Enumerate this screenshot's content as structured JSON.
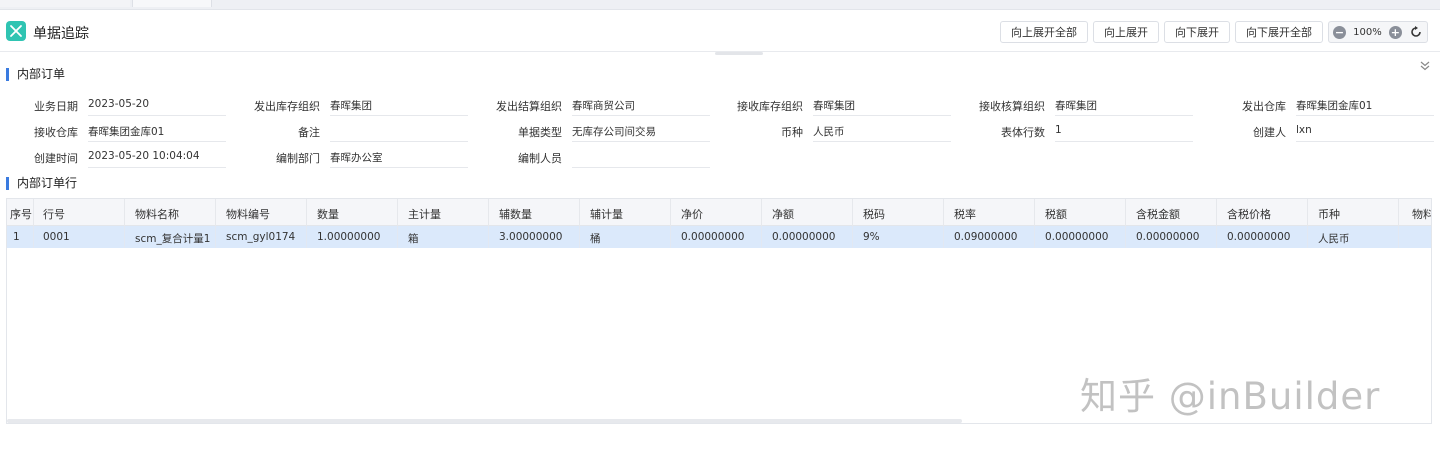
{
  "header": {
    "title": "单据追踪",
    "buttons": [
      "向上展开全部",
      "向上展开",
      "向下展开",
      "向下展开全部"
    ],
    "zoom": "100%"
  },
  "section_order": {
    "title": "内部订单"
  },
  "form": {
    "row1": [
      {
        "label": "业务日期",
        "value": "2023-05-20"
      },
      {
        "label": "发出库存组织",
        "value": "春晖集团"
      },
      {
        "label": "发出结算组织",
        "value": "春晖商贸公司"
      },
      {
        "label": "接收库存组织",
        "value": "春晖集团"
      },
      {
        "label": "接收核算组织",
        "value": "春晖集团"
      },
      {
        "label": "发出仓库",
        "value": "春晖集团金库01"
      }
    ],
    "row2": [
      {
        "label": "接收仓库",
        "value": "春晖集团金库01"
      },
      {
        "label": "备注",
        "value": ""
      },
      {
        "label": "单据类型",
        "value": "无库存公司间交易"
      },
      {
        "label": "币种",
        "value": "人民币"
      },
      {
        "label": "表体行数",
        "value": "1"
      },
      {
        "label": "创建人",
        "value": "lxn"
      }
    ],
    "row3": [
      {
        "label": "创建时间",
        "value": "2023-05-20 10:04:04"
      },
      {
        "label": "编制部门",
        "value": "春晖办公室"
      },
      {
        "label": "编制人员",
        "value": ""
      }
    ]
  },
  "section_lines": {
    "title": "内部订单行"
  },
  "grid": {
    "columns": [
      "序号",
      "行号",
      "物料名称",
      "物料编号",
      "数量",
      "主计量",
      "辅数量",
      "辅计量",
      "净价",
      "净额",
      "税码",
      "税率",
      "税额",
      "含税金额",
      "含税价格",
      "币种",
      "物料"
    ],
    "rows": [
      [
        "1",
        "0001",
        "scm_复合计量1",
        "scm_gyl0174",
        "1.00000000",
        "箱",
        "3.00000000",
        "桶",
        "0.00000000",
        "0.00000000",
        "9%",
        "0.09000000",
        "0.00000000",
        "0.00000000",
        "0.00000000",
        "人民币",
        ""
      ]
    ]
  },
  "watermark": "知乎 @inBuilder"
}
